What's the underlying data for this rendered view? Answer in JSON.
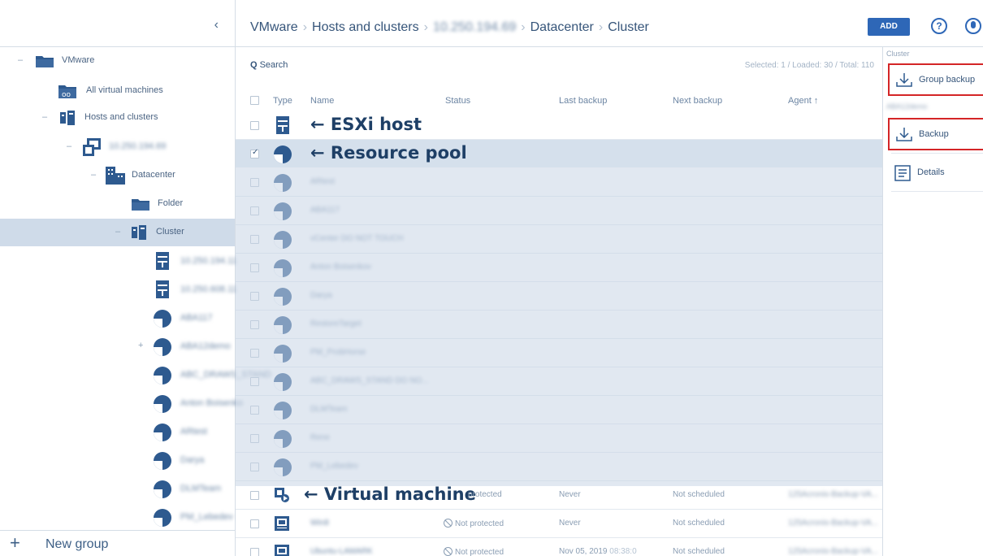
{
  "sidebar": {
    "collapse_glyph": "‹",
    "items": [
      {
        "label": "VMware",
        "icon": "folder-icon"
      },
      {
        "label": "All virtual machines",
        "icon": "all-vms-icon"
      },
      {
        "label": "Hosts and clusters",
        "icon": "hosts-clusters-icon"
      },
      {
        "label": "10.250.194.69",
        "icon": "vcenter-icon"
      },
      {
        "label": "Datacenter",
        "icon": "datacenter-icon"
      },
      {
        "label": "Folder",
        "icon": "folder-icon"
      },
      {
        "label": "Cluster",
        "icon": "cluster-icon"
      },
      {
        "label": "10.250.194.11",
        "icon": "esxi-host-icon"
      },
      {
        "label": "10.250.608.11",
        "icon": "esxi-host-icon"
      },
      {
        "label": "ABA117",
        "icon": "resource-pool-icon"
      },
      {
        "label": "ABA12demo",
        "icon": "resource-pool-icon"
      },
      {
        "label": "ABC_DRAWS_STAND",
        "icon": "resource-pool-icon"
      },
      {
        "label": "Anton Boisenko",
        "icon": "resource-pool-icon"
      },
      {
        "label": "ARtest",
        "icon": "resource-pool-icon"
      },
      {
        "label": "Darya",
        "icon": "resource-pool-icon"
      },
      {
        "label": "DLMTeam",
        "icon": "resource-pool-icon"
      },
      {
        "label": "PM_Lebedev",
        "icon": "resource-pool-icon"
      }
    ],
    "new_group": "New group"
  },
  "header": {
    "breadcrumb": [
      "VMware",
      "Hosts and clusters",
      "10.250.194.69",
      "Datacenter",
      "Cluster"
    ],
    "add_label": "ADD",
    "help_glyph": "?"
  },
  "main": {
    "search_label": "Search",
    "counts": "Selected: 1 / Loaded: 30 / Total: 110",
    "columns": {
      "type": "Type",
      "name": "Name",
      "status": "Status",
      "last_backup": "Last backup",
      "next_backup": "Next backup",
      "agent": "Agent ↑"
    },
    "annotations": {
      "esxi": "← ESXi host",
      "pool": "← Resource pool",
      "vm": "← Virtual machine"
    },
    "rows": [
      {
        "icon": "esxi-host-icon",
        "name": "",
        "status": "",
        "last": "",
        "next": "",
        "agent": ""
      },
      {
        "icon": "resource-pool-icon",
        "name": "",
        "status": "",
        "last": "",
        "next": "",
        "agent": "",
        "checked": true
      },
      {
        "icon": "resource-pool-icon",
        "name": "ARtest"
      },
      {
        "icon": "resource-pool-icon",
        "name": "ABA117"
      },
      {
        "icon": "resource-pool-icon",
        "name": "vCenter DO NOT TOUCH"
      },
      {
        "icon": "resource-pool-icon",
        "name": "Anton Boisenkov"
      },
      {
        "icon": "resource-pool-icon",
        "name": "Darya"
      },
      {
        "icon": "resource-pool-icon",
        "name": "RestoreTarget"
      },
      {
        "icon": "resource-pool-icon",
        "name": "PM_ProbHorse"
      },
      {
        "icon": "resource-pool-icon",
        "name": "ABC_DRAWS_STAND DO NO..."
      },
      {
        "icon": "resource-pool-icon",
        "name": "DLMTeam"
      },
      {
        "icon": "resource-pool-icon",
        "name": "Rene"
      },
      {
        "icon": "resource-pool-icon",
        "name": "PM_Lebedev"
      },
      {
        "icon": "vm-template-icon",
        "name": "",
        "status": "protected",
        "last": "Never",
        "next": "Not scheduled",
        "agent": "125Acronis-Backup-VA..."
      },
      {
        "icon": "vm-icon",
        "name": "Win8",
        "status": "Not protected",
        "last": "Never",
        "next": "Not scheduled",
        "agent": "125Acronis-Backup-VA..."
      },
      {
        "icon": "vm-icon",
        "name": "Ubuntu-LAMARK",
        "status": "Not protected",
        "last": "Nov 05, 2019",
        "last_time": "08:38:0",
        "next": "Not scheduled",
        "agent": "125Acronis-Backup-VA..."
      }
    ]
  },
  "right_panel": {
    "section1": "Cluster",
    "group_backup": "Group backup",
    "section2": "ABA12demo",
    "backup": "Backup",
    "details": "Details"
  }
}
